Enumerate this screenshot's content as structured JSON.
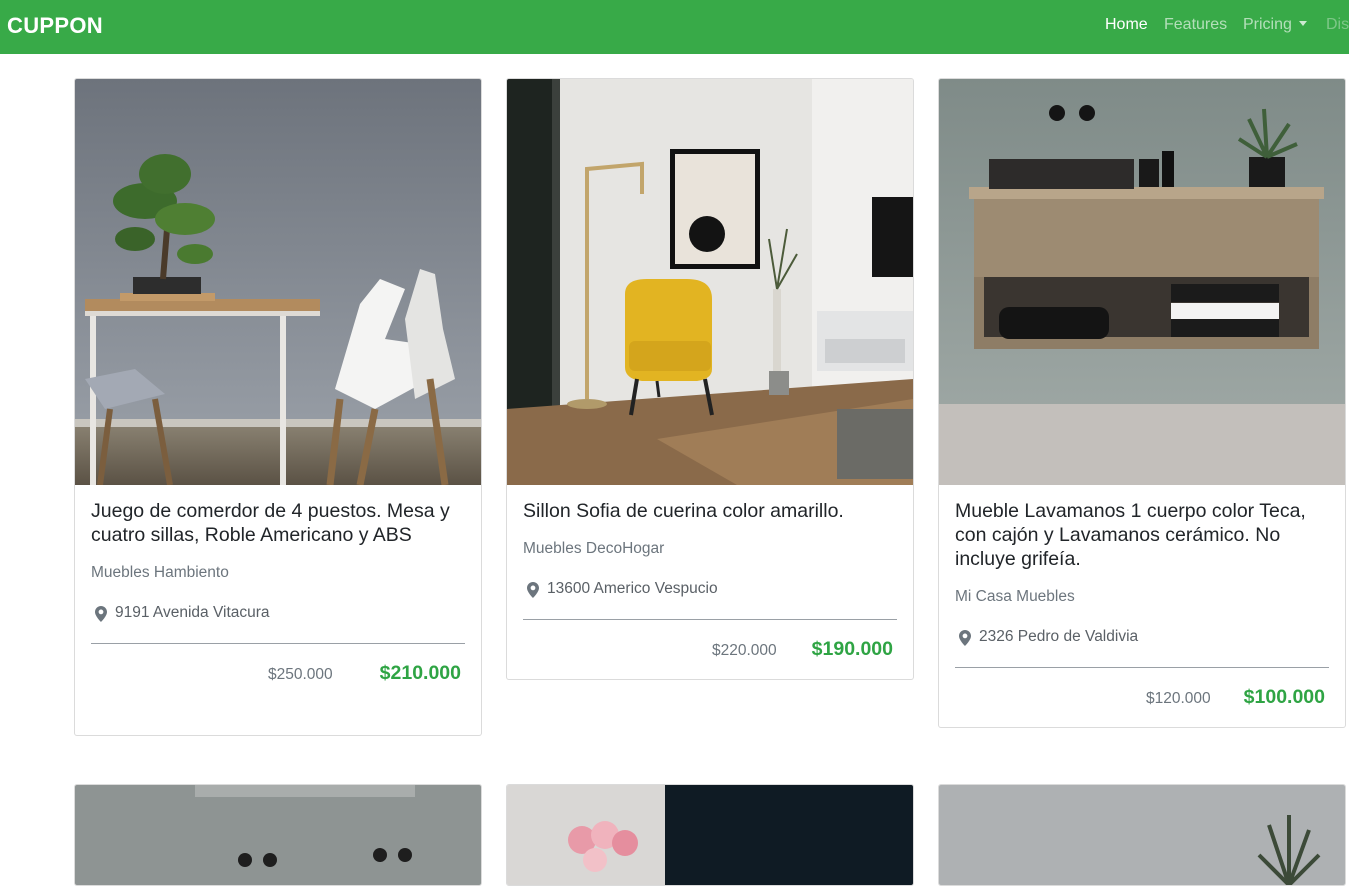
{
  "navbar": {
    "brand": "CUPPON",
    "links": [
      {
        "label": "Home",
        "active": true
      },
      {
        "label": "Features",
        "active": false
      },
      {
        "label": "Pricing",
        "active": false,
        "dropdown": true
      },
      {
        "label": "Dis",
        "active": false
      }
    ],
    "color": "#38aa48"
  },
  "cards": [
    {
      "title": "Juego de comerdor de 4 puestos. Mesa y cuatro sillas, Roble Americano y ABS",
      "store": "Muebles Hambiento",
      "address": "9191 Avenida Vitacura",
      "old_price": "$250.000",
      "new_price": "$210.000",
      "image_icon": "dining-table-photo"
    },
    {
      "title": "Sillon Sofia de cuerina color amarillo.",
      "store": "Muebles DecoHogar",
      "address": "13600 Americo Vespucio",
      "old_price": "$220.000",
      "new_price": "$190.000",
      "image_icon": "yellow-armchair-photo"
    },
    {
      "title": "Mueble Lavamanos 1 cuerpo color Teca, con cajón y Lavamanos cerámico. No incluye grifeía.",
      "store": "Mi Casa Muebles",
      "address": "2326 Pedro de Valdivia",
      "old_price": "$120.000",
      "new_price": "$100.000",
      "image_icon": "bathroom-vanity-photo"
    }
  ],
  "price_color": "#2fa444",
  "location_icon": "map-pin-icon"
}
